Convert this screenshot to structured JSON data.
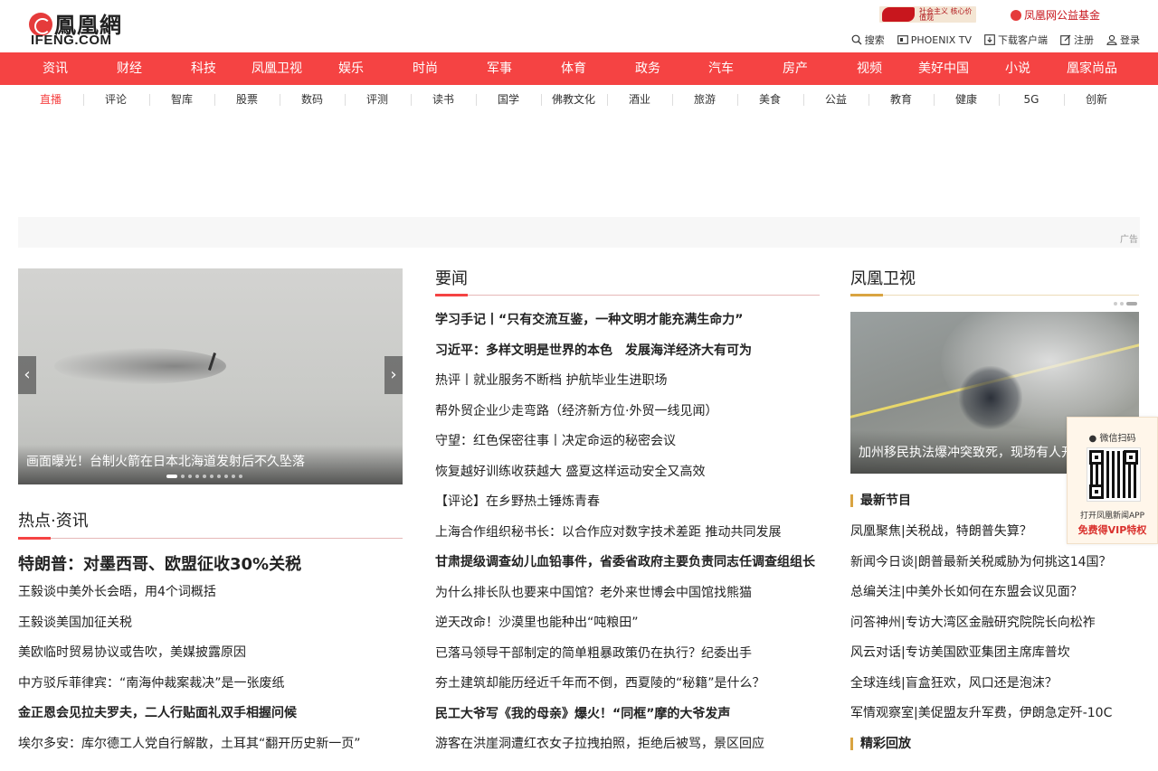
{
  "header": {
    "logo_cn": "鳳凰網",
    "logo_en": "IFENG.COM",
    "banner1_text": "社会主义 核心价值观",
    "banner2_text": "凤凰网公益基金",
    "toplinks": [
      "搜索",
      "PHOENIX TV",
      "下载客户端",
      "注册",
      "登录"
    ]
  },
  "mainnav": [
    "资讯",
    "财经",
    "科技",
    "凤凰卫视",
    "娱乐",
    "时尚",
    "军事",
    "体育",
    "政务",
    "汽车",
    "房产",
    "视频",
    "美好中国",
    "小说",
    "凰家尚品"
  ],
  "subnav": [
    "直播",
    "评论",
    "智库",
    "股票",
    "数码",
    "评测",
    "读书",
    "国学",
    "佛教文化",
    "酒业",
    "旅游",
    "美食",
    "公益",
    "教育",
    "健康",
    "5G",
    "创新"
  ],
  "ad": {
    "label": "广告"
  },
  "slider": {
    "caption": "画面曝光！台制火箭在日本北海道发射后不久坠落",
    "prev": "‹",
    "next": "›",
    "slide_count": 10,
    "active_index": 0
  },
  "hot": {
    "title": "热点·资讯",
    "headline": "特朗普：对墨西哥、欧盟征收30%关税",
    "items": [
      {
        "text": "王毅谈中美外长会晤，用4个词概括",
        "bold": false
      },
      {
        "text": "王毅谈美国加征关税",
        "bold": false
      },
      {
        "text": "美欧临时贸易协议或告吹，美媒披露原因",
        "bold": false
      },
      {
        "text": "中方驳斥菲律宾：“南海仲裁案裁决”是一张废纸",
        "bold": false
      },
      {
        "text": "金正恩会见拉夫罗夫，二人行贴面礼双手相握问候",
        "bold": true
      },
      {
        "text": "埃尔多安：库尔德工人党自行解散，土耳其“翻开历史新一页”",
        "bold": false
      }
    ]
  },
  "news": {
    "title": "要闻",
    "items": [
      {
        "text": "学习手记丨“只有交流互鉴，一种文明才能充满生命力”",
        "bold": true
      },
      {
        "text": "习近平：多样文明是世界的本色　发展海洋经济大有可为",
        "bold": true
      },
      {
        "text": "热评丨就业服务不断档 护航毕业生进职场",
        "bold": false
      },
      {
        "text": "帮外贸企业少走弯路（经济新方位·外贸一线见闻）",
        "bold": false
      },
      {
        "text": "守望：红色保密往事丨决定命运的秘密会议",
        "bold": false
      },
      {
        "text": "恢复越好训练收获越大 盛夏这样运动安全又高效",
        "bold": false
      },
      {
        "text": "【评论】在乡野热土锤炼青春",
        "bold": false
      },
      {
        "text": "上海合作组织秘书长：以合作应对数字技术差距 推动共同发展",
        "bold": false
      },
      {
        "text": "甘肃提级调查幼儿血铅事件，省委省政府主要负责同志任调查组组长",
        "bold": true
      },
      {
        "text": "为什么排长队也要来中国馆？老外来世博会中国馆找熊猫",
        "bold": false
      },
      {
        "text": "逆天改命！沙漠里也能种出“吨粮田”",
        "bold": false
      },
      {
        "text": "已落马领导干部制定的简单粗暴政策仍在执行？纪委出手",
        "bold": false
      },
      {
        "text": "夯土建筑却能历经近千年而不倒，西夏陵的“秘籍”是什么？",
        "bold": false
      },
      {
        "text": "民工大爷写《我的母亲》爆火！“同框”摩的大爷发声",
        "bold": true
      },
      {
        "text": "游客在洪崖洞遭红衣女子拉拽拍照，拒绝后被骂，景区回应",
        "bold": false
      }
    ]
  },
  "tv": {
    "title": "凤凰卫视",
    "caption": "加州移民执法爆冲突致死，现场有人开",
    "dot_count": 3,
    "active_dot": 2,
    "newest_label": "最新节目",
    "items": [
      "凤凰聚焦|关税战，特朗普失算？",
      "新闻今日谈|朗普最新关税威胁为何挑这14国？",
      "总编关注|中美外长如何在东盟会议见面？",
      "问答神州|专访大湾区金融研究院院长向松祚",
      "风云对话|专访美国欧亚集团主席库普坎",
      "全球连线|盲盒狂欢，风口还是泡沫？",
      "军情观察室|美促盟友升军费，伊朗急定歼-10C"
    ],
    "replay_label": "精彩回放"
  },
  "qr": {
    "title": "微信扫码",
    "line1": "打开凤凰新闻APP",
    "line2": "免费得VIP特权"
  }
}
